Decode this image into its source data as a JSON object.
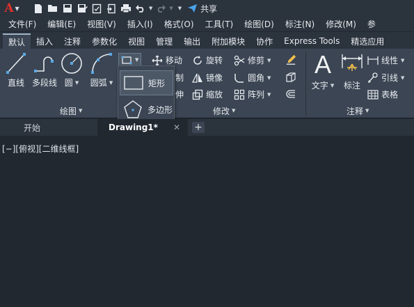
{
  "app": {
    "logo_letter": "A"
  },
  "quick_access": {
    "share_label": "共享",
    "icons": [
      "new-icon",
      "open-icon",
      "save-icon",
      "save-as-icon",
      "print-preview-icon",
      "import-icon",
      "print-icon",
      "undo-icon",
      "redo-icon",
      "customize-icon",
      "share-icon"
    ]
  },
  "menu": [
    "文件(F)",
    "编辑(E)",
    "视图(V)",
    "插入(I)",
    "格式(O)",
    "工具(T)",
    "绘图(D)",
    "标注(N)",
    "修改(M)",
    "参"
  ],
  "ribbon_tabs": [
    "默认",
    "插入",
    "注释",
    "参数化",
    "视图",
    "管理",
    "输出",
    "附加模块",
    "协作",
    "Express Tools",
    "精选应用"
  ],
  "active_ribbon_tab": "默认",
  "draw_panel": {
    "title": "绘图",
    "tools": {
      "line": "直线",
      "polyline": "多段线",
      "circle": "圆",
      "arc": "圆弧"
    }
  },
  "rect_dropdown": {
    "rectangle": "矩形",
    "polygon": "多边形"
  },
  "modify_panel": {
    "title": "修改",
    "move": "移动",
    "copy_partial": "制",
    "stretch_partial": "伸",
    "rotate": "旋转",
    "mirror": "镜像",
    "scale": "缩放",
    "trim": "修剪",
    "fillet": "圆角",
    "array": "阵列"
  },
  "annotation_panel": {
    "title": "注释",
    "text": "文字",
    "dimension": "标注",
    "linear": "线性",
    "leader": "引线",
    "table": "表格"
  },
  "doc_tabs": {
    "start": "开始",
    "drawing": "Drawing1*",
    "close": "✕",
    "new_tab": "+"
  },
  "canvas": {
    "viewport_label": "[−][俯视][二维线框]"
  },
  "colors": {
    "accent_red": "#e0312b",
    "share_blue": "#4aa3e8",
    "bg": "#212830",
    "ribbon": "#3b4553"
  }
}
